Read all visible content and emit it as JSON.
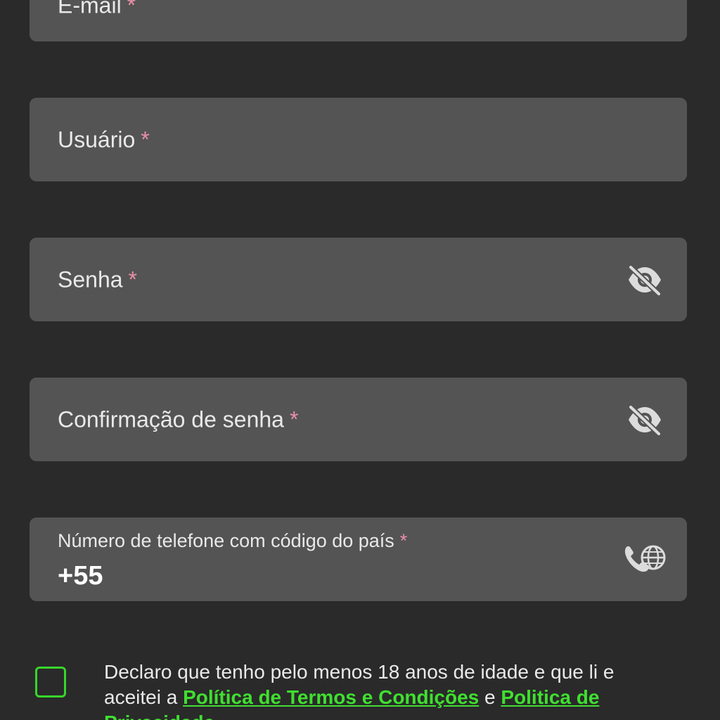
{
  "form": {
    "email": {
      "label": "E-mail",
      "required_mark": "*"
    },
    "username": {
      "label": "Usuário",
      "required_mark": "*"
    },
    "password": {
      "label": "Senha",
      "required_mark": "*",
      "icon": "eye-off-icon"
    },
    "password_confirm": {
      "label": "Confirmação de senha",
      "required_mark": "*",
      "icon": "eye-off-icon"
    },
    "phone": {
      "label": "Número de telefone com código do país",
      "required_mark": "*",
      "value": "+55",
      "icon": "phone-globe-icon"
    }
  },
  "consent": {
    "text_before": "Declaro que tenho pelo menos 18 anos de idade e que li e aceitei a ",
    "terms_link": "Política de Termos e Condições",
    "conjunction": " e ",
    "privacy_link": "Politica de Privacidade"
  },
  "colors": {
    "background": "#2a2a2a",
    "field_bg": "#545454",
    "required": "#e88fa8",
    "accent_green": "#3fe02f"
  }
}
